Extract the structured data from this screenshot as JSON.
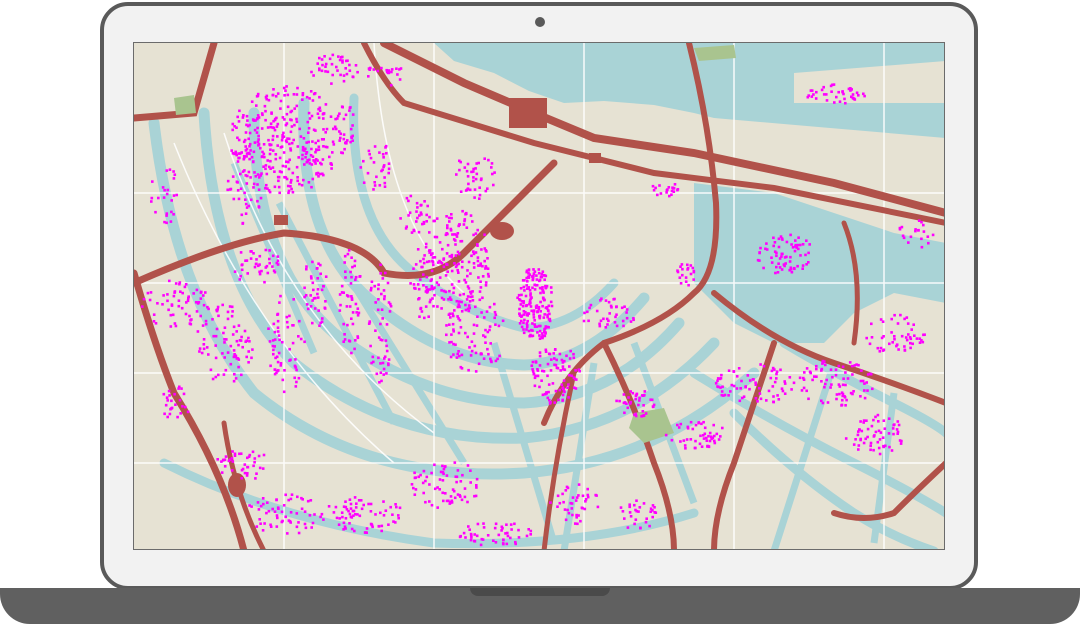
{
  "device": {
    "type": "laptop",
    "frame_color": "#5a5a5a",
    "bezel_color": "#f2f2f2"
  },
  "map": {
    "base_land_color": "#e6e2d3",
    "water_color": "#a9d3d6",
    "road_color": "#b1524a",
    "park_color": "#a9c48f",
    "street_color": "#ffffff",
    "point_color": "#ff00ff",
    "icons": [
      "laptop-camera-icon"
    ]
  }
}
